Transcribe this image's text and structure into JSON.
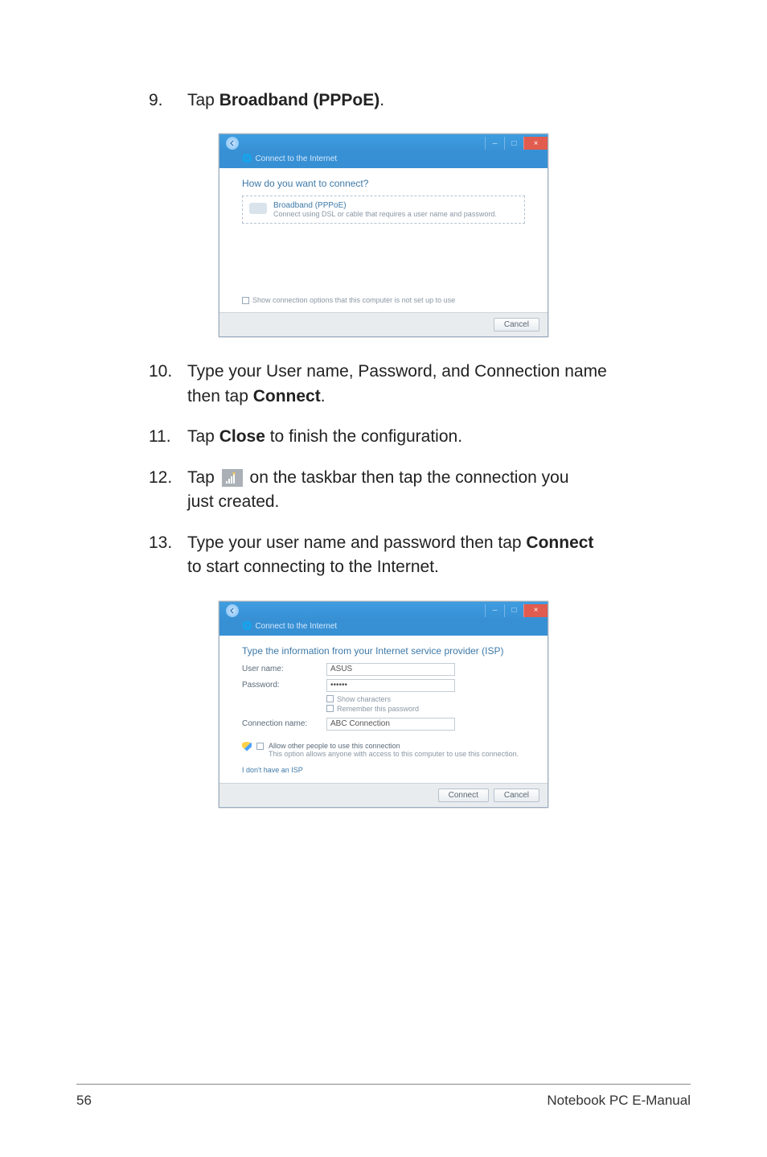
{
  "steps": {
    "s9": {
      "num": "9.",
      "pre": "Tap ",
      "bold": "Broadband (PPPoE)",
      "post": "."
    },
    "s10": {
      "num": "10.",
      "line1": "Type your User name, Password, and Connection name",
      "line2_pre": "then tap ",
      "line2_bold": "Connect",
      "line2_post": "."
    },
    "s11": {
      "num": "11.",
      "pre": "Tap ",
      "bold": "Close",
      "post": " to finish the configuration."
    },
    "s12": {
      "num": "12.",
      "pre": "Tap ",
      "mid": " on the taskbar then tap the connection you",
      "line2": "just created."
    },
    "s13": {
      "num": "13.",
      "pre": "Type your user name and password then tap ",
      "bold": "Connect",
      "post": "",
      "line2": "to start connecting to the Internet."
    }
  },
  "dlg1": {
    "subtitle": "Connect to the Internet",
    "heading": "How do you want to connect?",
    "opt_title": "Broadband (PPPoE)",
    "opt_sub": "Connect using DSL or cable that requires a user name and password.",
    "show_opts": "Show connection options that this computer is not set up to use",
    "cancel": "Cancel"
  },
  "dlg2": {
    "subtitle": "Connect to the Internet",
    "heading": "Type the information from your Internet service provider (ISP)",
    "user_lbl": "User name:",
    "user_val": "ASUS",
    "pass_lbl": "Password:",
    "pass_val": "••••••",
    "show_chars": "Show characters",
    "remember": "Remember this password",
    "conn_lbl": "Connection name:",
    "conn_val": "ABC Connection",
    "allow_t1": "Allow other people to use this connection",
    "allow_t2": "This option allows anyone with access to this computer to use this connection.",
    "noisp": "I don't have an ISP",
    "connect": "Connect",
    "cancel": "Cancel"
  },
  "footer": {
    "page": "56",
    "title": "Notebook PC E-Manual"
  }
}
